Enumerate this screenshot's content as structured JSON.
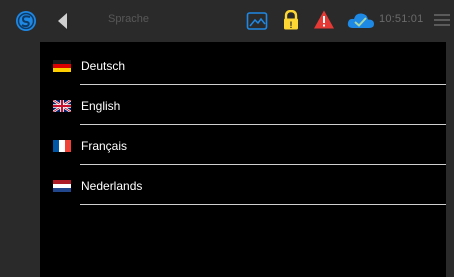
{
  "header": {
    "title": "Sprache",
    "time": "10:51:01",
    "icons": [
      "app-logo",
      "back-arrow",
      "image-icon",
      "lock-icon",
      "warning-icon",
      "cloud-icon",
      "hamburger-menu-icon"
    ]
  },
  "languages": [
    {
      "label": "Deutsch",
      "flag": "flag-de"
    },
    {
      "label": "English",
      "flag": "flag-uk"
    },
    {
      "label": "Français",
      "flag": "flag-fr"
    },
    {
      "label": "Nederlands",
      "flag": "flag-nl"
    }
  ],
  "colors": {
    "accent_blue": "#1e88e5",
    "warning_red": "#e53935",
    "lock_yellow": "#fdd835",
    "bar_bg": "#2a2a2a"
  }
}
